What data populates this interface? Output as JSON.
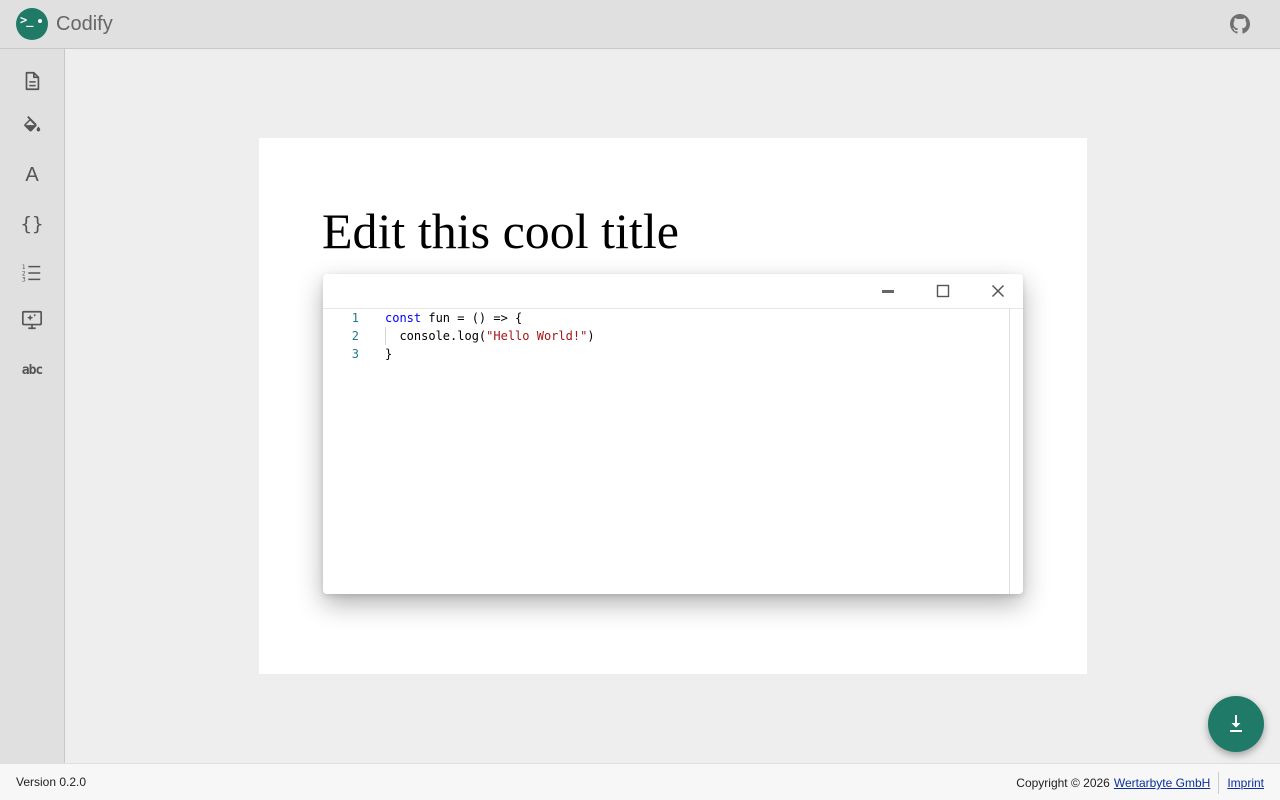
{
  "app": {
    "title": "Codify",
    "logo_glyph": ">_",
    "brand_color": "#1f7a68"
  },
  "header": {
    "github_icon": "github-icon"
  },
  "sidebar": {
    "items": [
      {
        "name": "document-icon"
      },
      {
        "name": "paint-bucket-icon"
      },
      {
        "name": "font-icon",
        "glyph": "A"
      },
      {
        "name": "code-braces-icon",
        "glyph": "{}"
      },
      {
        "name": "numbered-list-icon"
      },
      {
        "name": "presentation-icon"
      },
      {
        "name": "abc-icon",
        "glyph": "abc"
      }
    ]
  },
  "document": {
    "title": "Edit this cool title"
  },
  "editor": {
    "line_numbers": [
      "1",
      "2",
      "3"
    ],
    "lines": [
      {
        "kw": "const",
        "rest": " fun = () => {"
      },
      {
        "pre": "  console.log(",
        "str": "\"Hello World!\"",
        "post": ")"
      },
      {
        "text": "}"
      }
    ],
    "window_buttons": [
      "minimize-icon",
      "maximize-icon",
      "close-icon"
    ]
  },
  "fab": {
    "icon": "download-icon"
  },
  "footer": {
    "version": "Version 0.2.0",
    "copyright": "Copyright © 2026",
    "company": "Wertarbyte GmbH",
    "imprint": "Imprint"
  }
}
